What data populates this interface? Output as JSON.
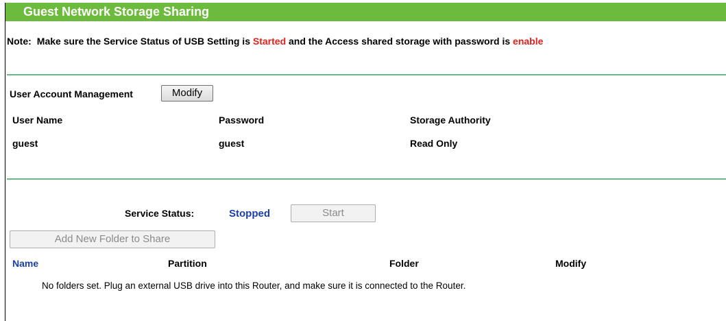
{
  "title": "Guest Network Storage Sharing",
  "note": {
    "label": "Note:",
    "text_part1": "Make sure the Service Status of USB Setting is ",
    "started": "Started",
    "text_part2": " and the Access shared storage with password is ",
    "enable": "enable"
  },
  "account": {
    "heading": "User Account Management",
    "modify_label": "Modify",
    "columns": [
      "User Name",
      "Password",
      "Storage Authority"
    ],
    "rows": [
      {
        "username": "guest",
        "password": "guest",
        "authority": "Read Only"
      }
    ]
  },
  "service": {
    "label": "Service Status:",
    "status": "Stopped",
    "start_label": "Start"
  },
  "folders": {
    "add_label": "Add New Folder to Share",
    "columns": [
      "Name",
      "Partition",
      "Folder",
      "Modify"
    ],
    "empty_message": "No folders set. Plug an external USB drive into this Router, and make sure it is connected to the Router."
  },
  "colors": {
    "title_bar": "#6dbb3c",
    "divider": "#6db58a",
    "accent_red": "#e0201a",
    "link_blue": "#1a3fa8"
  }
}
